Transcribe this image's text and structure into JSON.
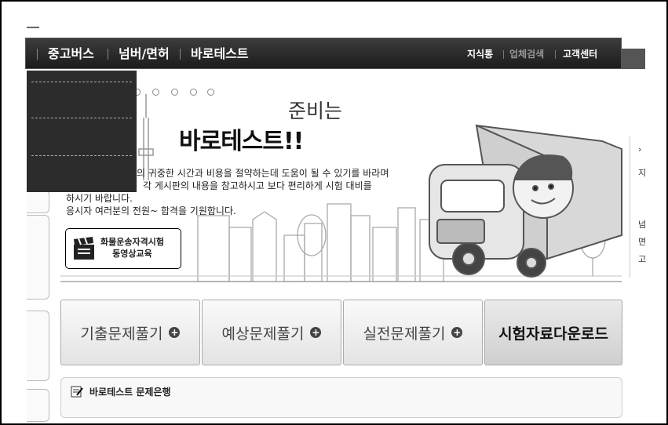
{
  "nav": {
    "items": [
      "중고버스",
      "넘버/면허",
      "바로테스트"
    ],
    "util": [
      "지식통",
      "업체검색",
      "고객센터"
    ]
  },
  "hero": {
    "subtitle": "준비는",
    "title": "바로테스트!!",
    "desc_line1": "의 귀중한 시간과 비용을 절약하는데 도움이 될 수 있기를 바라며",
    "desc_line2": "각 게시판의 내용을 참고하시고 보다 편리하게 시험 대비를",
    "desc_line3": "하시기 바랍니다.",
    "desc_line4": "응시자 여러분의 전원~ 합격을 기원합니다."
  },
  "promo": {
    "line1": "화물운송자격시험",
    "line2": "동영상교육"
  },
  "buttons": {
    "b1": "기출문제풀기",
    "b2": "예상문제풀기",
    "b3": "실전문제풀기",
    "b4": "시험자료다운로드",
    "plus": "+"
  },
  "qbank": {
    "title": "바로테스트 문제은행"
  },
  "right": {
    "arrow": "›",
    "t1": "지",
    "t2": "넘",
    "t3": "면",
    "t4": "고"
  }
}
